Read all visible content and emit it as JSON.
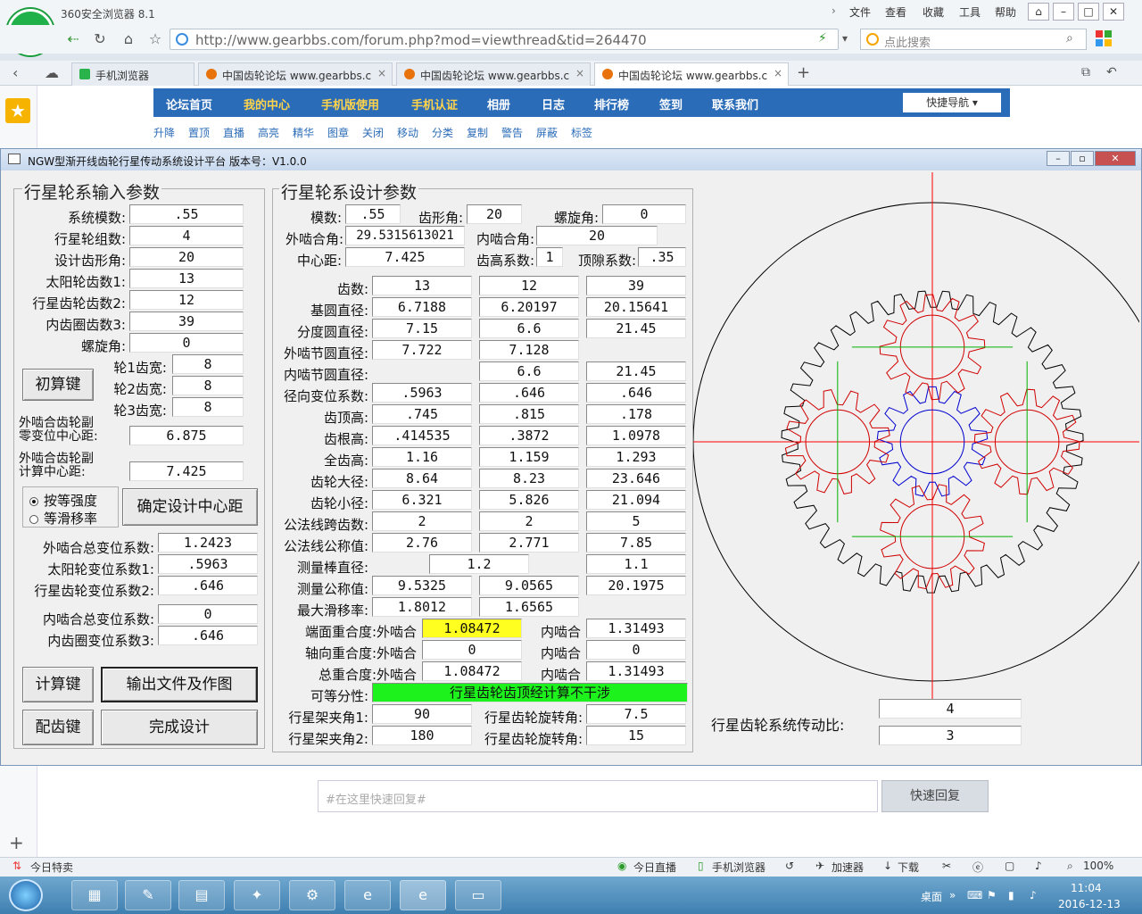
{
  "browser": {
    "title": "360安全浏览器 8.1",
    "menu": [
      "文件",
      "查看",
      "收藏",
      "工具",
      "帮助"
    ],
    "url": "http://www.gearbbs.com/forum.php?mod=viewthread&tid=264470",
    "search_placeholder": "点此搜索",
    "tabs": [
      {
        "label": "手机浏览器"
      },
      {
        "label": "中国齿轮论坛 www.gearbbs.c"
      },
      {
        "label": "中国齿轮论坛 www.gearbbs.c"
      },
      {
        "label": "中国齿轮论坛 www.gearbbs.c"
      }
    ],
    "tab_close": "×",
    "new_tab": "+"
  },
  "forum": {
    "nav": [
      "论坛首页",
      "我的中心",
      "手机版使用",
      "手机认证",
      "相册",
      "日志",
      "排行榜",
      "签到",
      "联系我们"
    ],
    "quick_nav": "快捷导航",
    "tools": [
      "升降",
      "置顶",
      "直播",
      "高亮",
      "精华",
      "图章",
      "关闭",
      "移动",
      "分类",
      "复制",
      "警告",
      "屏蔽",
      "标签"
    ],
    "reply_placeholder": "#在这里快速回复#",
    "reply_button": "快速回复"
  },
  "app": {
    "title": "NGW型渐开线齿轮行星传动系统设计平台  版本号：V1.0.0",
    "input_group": {
      "title": "行星轮系输入参数",
      "fields": [
        {
          "label": "系统模数:",
          "value": ".55"
        },
        {
          "label": "行星轮组数:",
          "value": "4"
        },
        {
          "label": "设计齿形角:",
          "value": "20"
        },
        {
          "label": "太阳轮齿数1:",
          "value": "13"
        },
        {
          "label": "行星齿轮齿数2:",
          "value": "12"
        },
        {
          "label": "内齿圈齿数3:",
          "value": "39"
        },
        {
          "label": "螺旋角:",
          "value": "0"
        }
      ],
      "calc_button": "初算键",
      "widths": [
        {
          "label": "轮1齿宽:",
          "value": "8"
        },
        {
          "label": "轮2齿宽:",
          "value": "8"
        },
        {
          "label": "轮3齿宽:",
          "value": "8"
        }
      ],
      "zero_center_label_1": "外啮合齿轮副",
      "zero_center_label_2": "零变位中心距:",
      "zero_center_value": "6.875",
      "calc_center_label_1": "外啮合齿轮副",
      "calc_center_label_2": "计算中心距:",
      "calc_center_value": "7.425",
      "radio_strength": "按等强度",
      "radio_slip": "等滑移率",
      "confirm_center_button": "确定设计中心距",
      "shift_fields": [
        {
          "label": "外啮合总变位系数:",
          "value": "1.2423"
        },
        {
          "label": "太阳轮变位系数1:",
          "value": ".5963"
        },
        {
          "label": "行星齿轮变位系数2:",
          "value": ".646"
        },
        {
          "label": "内啮合总变位系数:",
          "value": "0"
        },
        {
          "label": "内齿圈变位系数3:",
          "value": ".646"
        }
      ],
      "compute_button": "计算键",
      "output_button": "输出文件及作图",
      "match_button": "配齿键",
      "finish_button": "完成设计"
    },
    "design_group": {
      "title": "行星轮系设计参数",
      "module_label": "模数:",
      "module": ".55",
      "profile_angle_label": "齿形角:",
      "profile_angle": "20",
      "helix_label": "螺旋角:",
      "helix": "0",
      "ext_angle_label": "外啮合角:",
      "ext_angle": "29.5315613021",
      "int_angle_label": "内啮合角:",
      "int_angle": "20",
      "center_label": "中心距:",
      "center": "7.425",
      "addendum_coef_label": "齿高系数:",
      "addendum_coef": "1",
      "clearance_coef_label": "顶隙系数:",
      "clearance_coef": ".35",
      "rows": [
        {
          "label": "齿数:",
          "values": [
            "13",
            "12",
            "39"
          ]
        },
        {
          "label": "基圆直径:",
          "values": [
            "6.7188",
            "6.20197",
            "20.15641"
          ]
        },
        {
          "label": "分度圆直径:",
          "values": [
            "7.15",
            "6.6",
            "21.45"
          ]
        },
        {
          "label": "外啮节圆直径:",
          "values": [
            "7.722",
            "7.128",
            ""
          ]
        },
        {
          "label": "内啮节圆直径:",
          "values": [
            "",
            "6.6",
            "21.45"
          ]
        },
        {
          "label": "径向变位系数:",
          "values": [
            ".5963",
            ".646",
            ".646"
          ]
        },
        {
          "label": "齿顶高:",
          "values": [
            ".745",
            ".815",
            ".178"
          ]
        },
        {
          "label": "齿根高:",
          "values": [
            ".414535",
            ".3872",
            "1.0978"
          ]
        },
        {
          "label": "全齿高:",
          "values": [
            "1.16",
            "1.159",
            "1.293"
          ]
        },
        {
          "label": "齿轮大径:",
          "values": [
            "8.64",
            "8.23",
            "23.646"
          ]
        },
        {
          "label": "齿轮小径:",
          "values": [
            "6.321",
            "5.826",
            "21.094"
          ]
        },
        {
          "label": "公法线跨齿数:",
          "values": [
            "2",
            "2",
            "5"
          ]
        },
        {
          "label": "公法线公称值:",
          "values": [
            "2.76",
            "2.771",
            "7.85"
          ]
        }
      ],
      "rod_label": "测量棒直径:",
      "rod_12": "1.2",
      "rod_3": "1.1",
      "measure_label": "测量公称值:",
      "measure": [
        "9.5325",
        "9.0565",
        "20.1975"
      ],
      "slip_label": "最大滑移率:",
      "slip": [
        "1.8012",
        "1.6565"
      ],
      "transverse_label": "端面重合度:外啮合",
      "transverse_ext": "1.08472",
      "internal_label": "内啮合",
      "transverse_int": "1.31493",
      "axial_label": "轴向重合度:外啮合",
      "axial_ext": "0",
      "axial_int": "0",
      "total_label": "总重合度:外啮合",
      "total_ext": "1.08472",
      "total_int": "1.31493",
      "assembly_label": "可等分性:",
      "assembly": "行星齿轮齿顶经计算不干涉",
      "carrier1_label": "行星架夹角1:",
      "carrier1": "90",
      "carrier2_label": "行星架夹角2:",
      "carrier2": "180",
      "rot_label": "行星齿轮旋转角:",
      "rot1": "7.5",
      "rot2": "15"
    },
    "ratio_label": "行星齿轮系统传动比:",
    "ratio_values": [
      "4",
      "3"
    ]
  },
  "status": {
    "left": "今日特卖",
    "items": [
      "今日直播",
      "手机浏览器",
      "加速器",
      "下载"
    ],
    "zoom": "100%"
  },
  "taskbar": {
    "desktop": "桌面",
    "time": "11:04",
    "date": "2016-12-13"
  },
  "colors": {
    "sun_gear": "#0000d0",
    "planet_gear": "#d00000",
    "ring_gear": "#000000",
    "centerline_red": "#ff0000",
    "centerline_green": "#00b000",
    "highlight_yellow": "#ffff20",
    "highlight_green": "#1df21d"
  }
}
